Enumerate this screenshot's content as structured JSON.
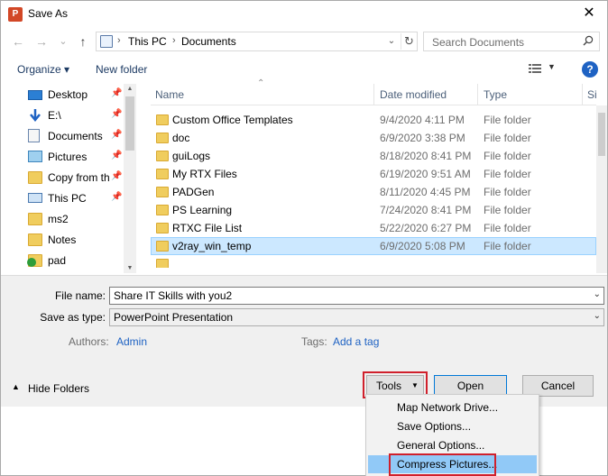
{
  "window": {
    "title": "Save As",
    "app_icon_letter": "P",
    "close_glyph": "✕"
  },
  "nav_glyphs": {
    "back": "←",
    "forward": "→",
    "recent": "⌄",
    "up": "↑"
  },
  "address": {
    "crumbs": [
      "This PC",
      "Documents"
    ],
    "separator": "›",
    "dropdown_glyph": "⌄",
    "refresh_glyph": "↻"
  },
  "search": {
    "placeholder": "Search Documents"
  },
  "toolbar": {
    "organize_label": "Organize ▾",
    "new_folder_label": "New folder",
    "view_dd_glyph": "▼",
    "help_label": "?"
  },
  "sidebar": {
    "items": [
      {
        "label": "Desktop",
        "icon": "desktop-icon",
        "pinned": true
      },
      {
        "label": "E:\\",
        "icon": "download-icon",
        "pinned": true
      },
      {
        "label": "Documents",
        "icon": "documents-icon",
        "pinned": true
      },
      {
        "label": "Pictures",
        "icon": "pictures-icon",
        "pinned": true
      },
      {
        "label": "Copy from th",
        "icon": "folder-icon",
        "pinned": true
      },
      {
        "label": "This PC",
        "icon": "pc-icon",
        "pinned": true
      },
      {
        "label": "ms2",
        "icon": "folder-icon",
        "pinned": false
      },
      {
        "label": "Notes",
        "icon": "folder-icon",
        "pinned": false
      },
      {
        "label": "pad",
        "icon": "folder-sync-icon",
        "pinned": false
      }
    ],
    "pin_glyph": "📌"
  },
  "file_list": {
    "columns": {
      "name": "Name",
      "date": "Date modified",
      "type": "Type",
      "size": "Si"
    },
    "rows": [
      {
        "name": "Custom Office Templates",
        "date": "9/4/2020 4:11 PM",
        "type": "File folder"
      },
      {
        "name": "doc",
        "date": "6/9/2020 3:38 PM",
        "type": "File folder"
      },
      {
        "name": "guiLogs",
        "date": "8/18/2020 8:41 PM",
        "type": "File folder"
      },
      {
        "name": "My RTX Files",
        "date": "6/19/2020 9:51 AM",
        "type": "File folder"
      },
      {
        "name": "PADGen",
        "date": "8/11/2020 4:45 PM",
        "type": "File folder"
      },
      {
        "name": "PS Learning",
        "date": "7/24/2020 8:41 PM",
        "type": "File folder"
      },
      {
        "name": "RTXC File List",
        "date": "5/22/2020 6:27 PM",
        "type": "File folder"
      },
      {
        "name": "v2ray_win_temp",
        "date": "6/9/2020 5:08 PM",
        "type": "File folder",
        "selected": true
      }
    ]
  },
  "form": {
    "file_name_label": "File name:",
    "file_name_value": "Share IT Skills with you2",
    "save_type_label": "Save as type:",
    "save_type_value": "PowerPoint Presentation",
    "authors_label": "Authors:",
    "authors_value": "Admin",
    "tags_label": "Tags:",
    "tags_value": "Add a tag",
    "combo_dd_glyph": "⌄"
  },
  "footer": {
    "hide_folders_label": "Hide Folders",
    "hide_folders_glyph": "▲",
    "tools_label": "Tools",
    "tools_dd_glyph": "▼",
    "open_label": "Open",
    "cancel_label": "Cancel"
  },
  "tools_menu": {
    "items": [
      {
        "label": "Map Network Drive..."
      },
      {
        "label": "Save Options..."
      },
      {
        "label": "General Options..."
      },
      {
        "label": "Compress Pictures...",
        "highlighted": true
      }
    ]
  },
  "colors": {
    "accent": "#0078d7",
    "highlight_box": "#d0202c",
    "selection": "#cce8ff",
    "menu_highlight": "#91c9f7",
    "link": "#1e62c3",
    "folder": "#f0cd5e"
  }
}
